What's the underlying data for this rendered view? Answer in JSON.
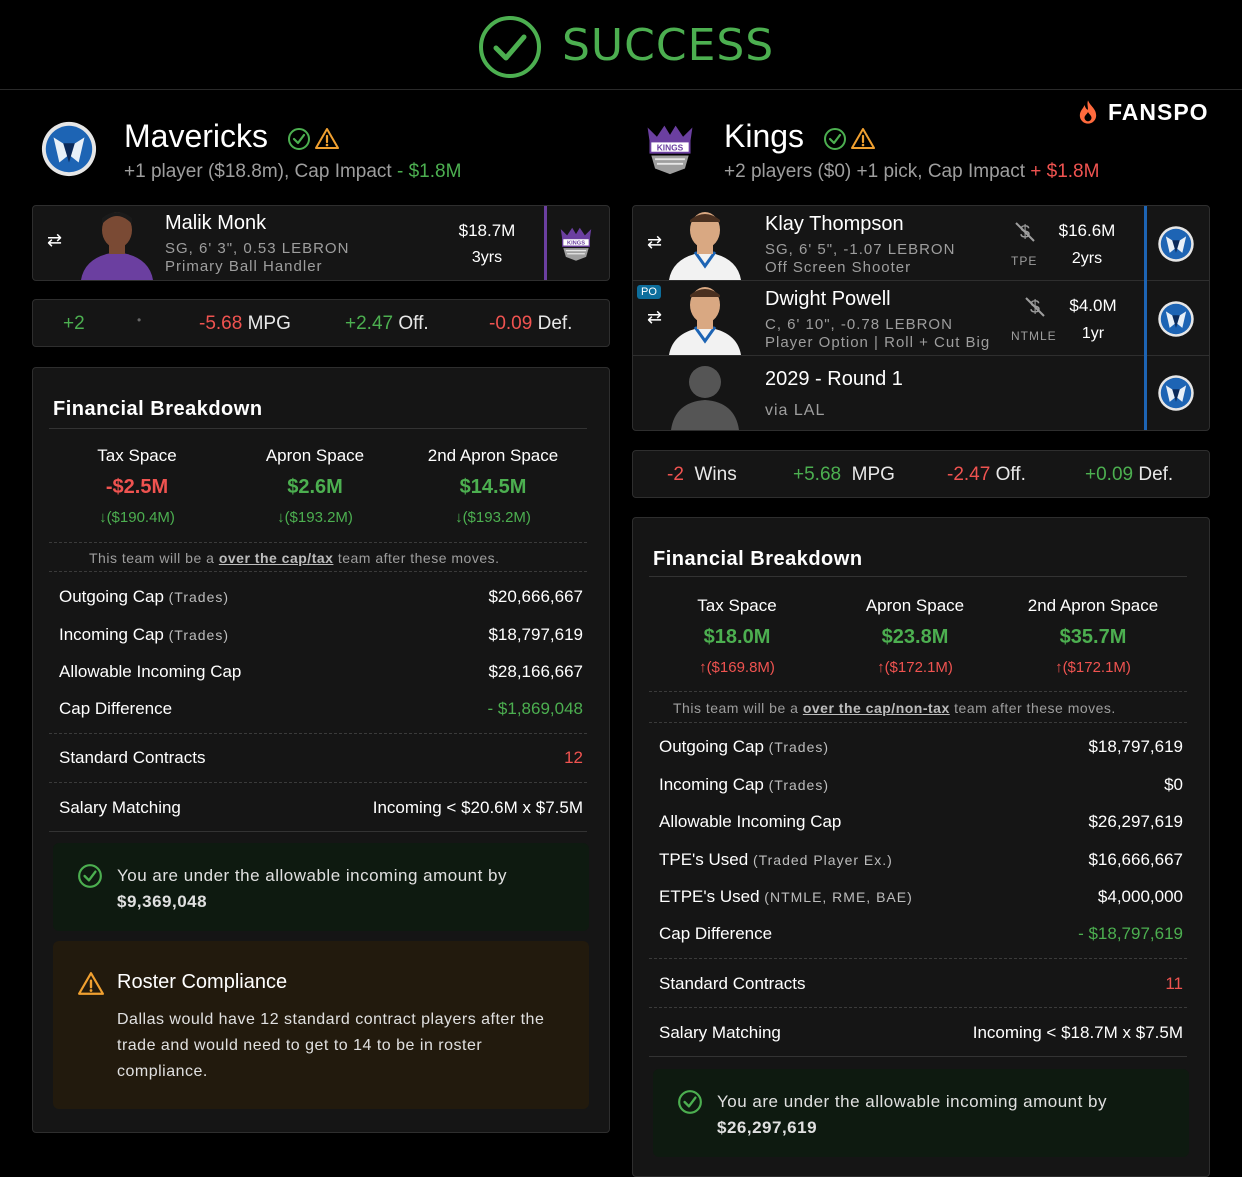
{
  "header": {
    "status": "SUCCESS",
    "brand": "FANSPO"
  },
  "colors": {
    "success": "#4caf50",
    "danger": "#ef5350",
    "warning": "#f0a030",
    "mavs_blue": "#1d64b4",
    "kings_purple": "#6b3fa0"
  },
  "left": {
    "team": "Mavericks",
    "summary_prefix": "+1 player ($18.8m), Cap Impact ",
    "summary_impact": "- $1.8M",
    "player": {
      "name": "Malik Monk",
      "info1": "SG, 6' 3\", 0.53 LEBRON",
      "info2": "Primary Ball Handler",
      "salary": "$18.7M",
      "years": "3yrs"
    },
    "stats": {
      "wins": "+2",
      "mpg_val": "-5.68",
      "mpg_lbl": "MPG",
      "off_val": "+2.47",
      "off_lbl": "Off.",
      "def_val": "-0.09",
      "def_lbl": "Def."
    },
    "fin": {
      "title": "Financial Breakdown",
      "tax_lbl": "Tax Space",
      "tax_val": "-$2.5M",
      "tax_chg": "($190.4M)",
      "apron_lbl": "Apron Space",
      "apron_val": "$2.6M",
      "apron_chg": "($193.2M)",
      "apron2_lbl": "2nd Apron Space",
      "apron2_val": "$14.5M",
      "apron2_chg": "($193.2M)",
      "note_pre": "This team will be a ",
      "note_link": "over the cap/tax",
      "note_post": " team after these moves.",
      "outgoing_lbl": "Outgoing Cap",
      "outgoing_sub": "(Trades)",
      "outgoing_val": "$20,666,667",
      "incoming_lbl": "Incoming Cap",
      "incoming_sub": "(Trades)",
      "incoming_val": "$18,797,619",
      "allow_lbl": "Allowable Incoming Cap",
      "allow_val": "$28,166,667",
      "diff_lbl": "Cap Difference",
      "diff_val": "- $1,869,048",
      "std_lbl": "Standard Contracts",
      "std_val": "12",
      "match_lbl": "Salary Matching",
      "match_val": "Incoming < $20.6M x $7.5M",
      "ok_text": "You are under the allowable incoming amount by",
      "ok_amount": "$9,369,048",
      "warn_title": "Roster Compliance",
      "warn_text": "Dallas would have 12 standard contract players after the trade and would need to get to 14 to be in roster compliance."
    }
  },
  "right": {
    "team": "Kings",
    "summary_prefix": "+2 players ($0) +1 pick, Cap Impact ",
    "summary_impact": "+ $1.8M",
    "players": [
      {
        "name": "Klay Thompson",
        "info1": "SG, 6' 5\", -1.07 LEBRON",
        "info2": "Off Screen Shooter",
        "salary": "$16.6M",
        "years": "2yrs",
        "tag": "TPE"
      },
      {
        "name": "Dwight Powell",
        "info1": "C, 6' 10\", -0.78 LEBRON",
        "info2": "Player Option | Roll + Cut Big",
        "salary": "$4.0M",
        "years": "1yr",
        "tag": "NTMLE",
        "badge": "PO"
      },
      {
        "name": "2029 - Round 1",
        "info1": "via LAL"
      }
    ],
    "stats": {
      "wins_val": "-2",
      "wins_lbl": "Wins",
      "mpg_val": "+5.68",
      "mpg_lbl": "MPG",
      "off_val": "-2.47",
      "off_lbl": "Off.",
      "def_val": "+0.09",
      "def_lbl": "Def."
    },
    "fin": {
      "title": "Financial Breakdown",
      "tax_lbl": "Tax Space",
      "tax_val": "$18.0M",
      "tax_chg": "($169.8M)",
      "apron_lbl": "Apron Space",
      "apron_val": "$23.8M",
      "apron_chg": "($172.1M)",
      "apron2_lbl": "2nd Apron Space",
      "apron2_val": "$35.7M",
      "apron2_chg": "($172.1M)",
      "note_pre": "This team will be a ",
      "note_link": "over the cap/non-tax",
      "note_post": " team after these moves.",
      "outgoing_lbl": "Outgoing Cap",
      "outgoing_sub": "(Trades)",
      "outgoing_val": "$18,797,619",
      "incoming_lbl": "Incoming Cap",
      "incoming_sub": "(Trades)",
      "incoming_val": "$0",
      "allow_lbl": "Allowable Incoming Cap",
      "allow_val": "$26,297,619",
      "tpe_lbl": "TPE's Used",
      "tpe_sub": "(Traded Player Ex.)",
      "tpe_val": "$16,666,667",
      "etpe_lbl": "ETPE's Used",
      "etpe_sub": "(NTMLE, RME, BAE)",
      "etpe_val": "$4,000,000",
      "diff_lbl": "Cap Difference",
      "diff_val": "- $18,797,619",
      "std_lbl": "Standard Contracts",
      "std_val": "11",
      "match_lbl": "Salary Matching",
      "match_val": "Incoming < $18.7M x $7.5M",
      "ok_text": "You are under the allowable incoming amount by",
      "ok_amount": "$26,297,619"
    }
  }
}
